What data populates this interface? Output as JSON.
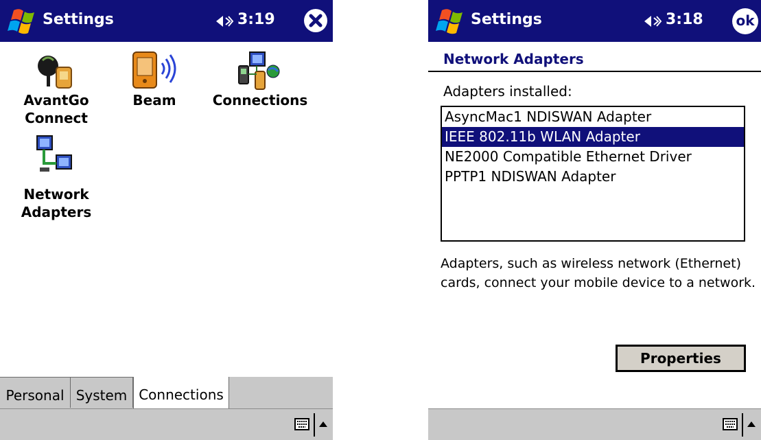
{
  "left_screen": {
    "title": "Settings",
    "time": "3:19",
    "icons": [
      {
        "label_line1": "AvantGo",
        "label_line2": "Connect"
      },
      {
        "label_line1": "Beam"
      },
      {
        "label_line1": "Connections"
      },
      {
        "label_line1": "Network",
        "label_line2": "Adapters"
      }
    ],
    "tabs": [
      "Personal",
      "System",
      "Connections"
    ],
    "active_tab": "Connections"
  },
  "right_screen": {
    "title": "Settings",
    "time": "3:18",
    "ok_label": "ok",
    "section_title": "Network Adapters",
    "list_label": "Adapters installed:",
    "adapters": [
      "AsyncMac1 NDISWAN Adapter",
      "IEEE 802.11b WLAN Adapter",
      "NE2000 Compatible Ethernet Driver",
      "PPTP1 NDISWAN Adapter"
    ],
    "selected_adapter": "IEEE 802.11b WLAN Adapter",
    "description": "Adapters, such as wireless network (Ethernet) cards, connect your mobile device to a network.",
    "properties_label": "Properties"
  },
  "colors": {
    "title_bar": "#10107a",
    "selection": "#10107a",
    "bar_gray": "#c8c8c8"
  },
  "icon_names": [
    "windows-start-icon",
    "speaker-icon",
    "close-icon",
    "keyboard-icon",
    "up-arrow-icon"
  ]
}
